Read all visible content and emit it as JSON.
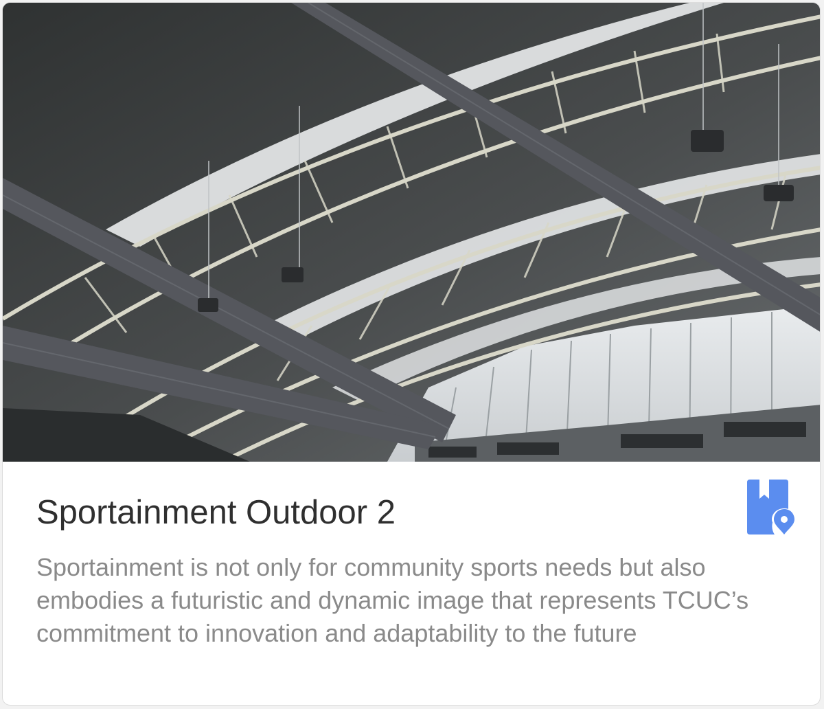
{
  "card": {
    "title": "Sportainment Outdoor 2",
    "description": "Sportainment is not only for community sports needs but also embodies a futuristic and dynamic image that represents TCUC’s commitment to innovation and adaptability to the future",
    "image": {
      "subject": "stadium-roof-truss-photo"
    },
    "action_icon": "bookmark-location-icon"
  },
  "colors": {
    "title": "#2f2f2f",
    "description": "#8a8a8a",
    "icon_blue": "#5b8def",
    "card_background": "#ffffff"
  }
}
